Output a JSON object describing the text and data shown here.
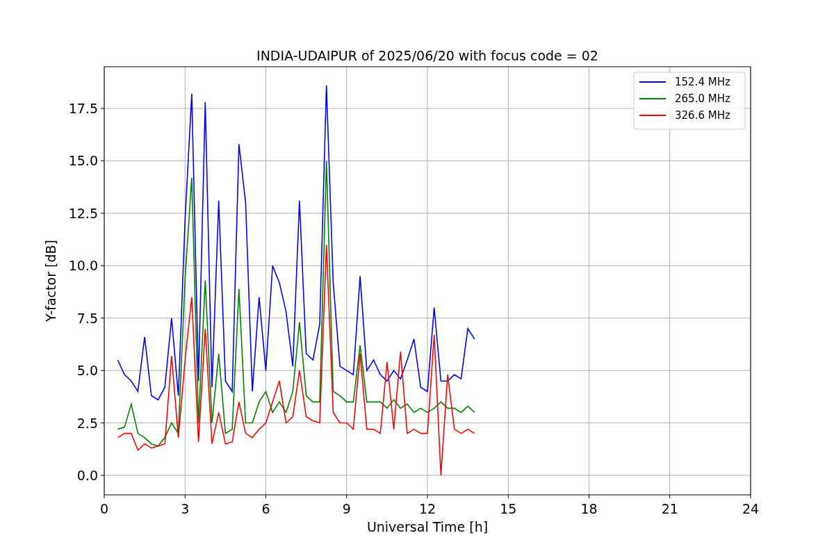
{
  "figure": {
    "chart_data": {
      "type": "line",
      "title": "INDIA-UDAIPUR of 2025/06/20 with focus code = 02",
      "xlabel": "Universal Time [h]",
      "ylabel": "Y-factor [dB]",
      "x": [
        0.5,
        0.75,
        1,
        1.25,
        1.5,
        1.75,
        2,
        2.25,
        2.5,
        2.75,
        3,
        3.25,
        3.5,
        3.75,
        4,
        4.25,
        4.5,
        4.75,
        5,
        5.25,
        5.5,
        5.75,
        6,
        6.25,
        6.5,
        6.75,
        7,
        7.25,
        7.5,
        7.75,
        8,
        8.25,
        8.5,
        8.75,
        9,
        9.25,
        9.5,
        9.75,
        10,
        10.25,
        10.5,
        10.75,
        11,
        11.25,
        11.5,
        11.75,
        12,
        12.25,
        12.5,
        12.75,
        13,
        13.25,
        13.5,
        13.75
      ],
      "series": [
        {
          "name": "152.4 MHz",
          "color": "#0000ff",
          "values": [
            5.5,
            4.8,
            4.5,
            4.0,
            6.6,
            3.8,
            3.6,
            4.2,
            7.5,
            3.8,
            12.2,
            18.2,
            4.5,
            17.8,
            4.2,
            13.1,
            4.5,
            4.0,
            15.8,
            13.0,
            4.0,
            8.5,
            5.0,
            10.0,
            9.2,
            7.8,
            5.2,
            13.1,
            5.8,
            5.5,
            7.2,
            18.6,
            9.2,
            5.2,
            5.0,
            4.8,
            9.5,
            5.0,
            5.5,
            4.8,
            4.5,
            5.0,
            4.6,
            5.5,
            6.5,
            4.2,
            4.0,
            8.0,
            4.5,
            4.5,
            4.8,
            4.6,
            7.0,
            6.5
          ]
        },
        {
          "name": "265.0 MHz",
          "color": "#008000",
          "values": [
            2.2,
            2.3,
            3.4,
            2.0,
            1.8,
            1.5,
            1.4,
            1.8,
            2.5,
            2.0,
            9.4,
            14.2,
            2.5,
            9.3,
            2.5,
            5.8,
            2.0,
            2.2,
            8.9,
            2.5,
            2.5,
            3.5,
            4.0,
            3.0,
            3.5,
            3.0,
            4.0,
            7.3,
            3.8,
            3.5,
            3.5,
            15.0,
            4.0,
            3.8,
            3.5,
            3.5,
            6.2,
            3.5,
            3.5,
            3.5,
            3.2,
            3.6,
            3.2,
            3.4,
            3.0,
            3.2,
            3.0,
            3.2,
            3.5,
            3.2,
            3.2,
            3.0,
            3.3,
            3.0
          ]
        },
        {
          "name": "326.6 MHz",
          "color": "#ff0000",
          "values": [
            1.8,
            2.0,
            2.0,
            1.2,
            1.5,
            1.3,
            1.4,
            1.5,
            5.7,
            1.8,
            5.5,
            8.5,
            1.6,
            7.0,
            1.5,
            3.0,
            1.5,
            1.6,
            3.5,
            2.0,
            1.8,
            2.2,
            2.5,
            3.5,
            4.5,
            2.5,
            2.8,
            5.0,
            2.8,
            2.6,
            2.5,
            11.0,
            3.0,
            2.5,
            2.5,
            2.2,
            5.8,
            2.2,
            2.2,
            2.0,
            5.4,
            2.2,
            5.9,
            2.0,
            2.2,
            2.0,
            2.0,
            6.7,
            0.0,
            4.8,
            2.2,
            2.0,
            2.2,
            2.0
          ]
        }
      ],
      "xlim": [
        0,
        24
      ],
      "ylim": [
        -0.93,
        19.49
      ],
      "grid": true,
      "legend": true,
      "xticks": [
        0,
        3,
        6,
        9,
        12,
        15,
        18,
        21,
        24
      ],
      "yticks": [
        {
          "value": 0,
          "label": "0.0"
        },
        {
          "value": 2.5,
          "label": "2.5"
        },
        {
          "value": 5,
          "label": "5.0"
        },
        {
          "value": 7.5,
          "label": "7.5"
        },
        {
          "value": 10,
          "label": "10.0"
        },
        {
          "value": 12.5,
          "label": "12.5"
        },
        {
          "value": 15,
          "label": "15.0"
        },
        {
          "value": 17.5,
          "label": "17.5"
        }
      ]
    }
  }
}
